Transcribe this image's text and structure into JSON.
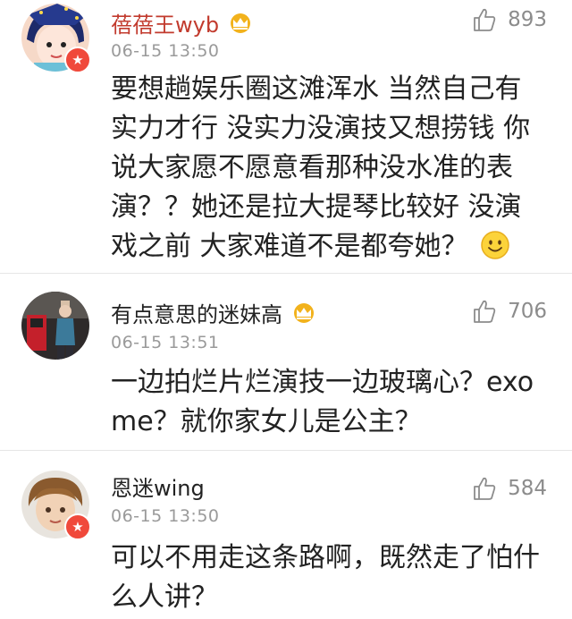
{
  "comments": [
    {
      "username": "蓓蓓王wyb",
      "username_color": "#c23b2e",
      "badge": "crown-badge-icon",
      "timestamp": "06-15 13:50",
      "likes": "893",
      "text": "要想趟娱乐圈这滩浑水 当然自己有实力才行 没实力没演技又想捞钱 你说大家愿不愿意看那种没水准的表演？？她还是拉大提琴比较好 没演戏之前 大家难道不是都夸她？",
      "emoji": "smiley-emoji-icon"
    },
    {
      "username": "有点意思的迷妹高",
      "username_color": "#222222",
      "badge": "crown-badge-icon",
      "timestamp": "06-15 13:51",
      "likes": "706",
      "text": "一边拍烂片烂演技一边玻璃心？exo me？就你家女儿是公主？"
    },
    {
      "username": "恩迷wing",
      "username_color": "#222222",
      "timestamp": "06-15 13:50",
      "likes": "584",
      "text": "可以不用走这条路啊，既然走了怕什么人讲？"
    }
  ],
  "colors": {
    "verified_badge": "#f0493b",
    "meta_gray": "#9a9a9a",
    "crown": "#f2b21c"
  }
}
